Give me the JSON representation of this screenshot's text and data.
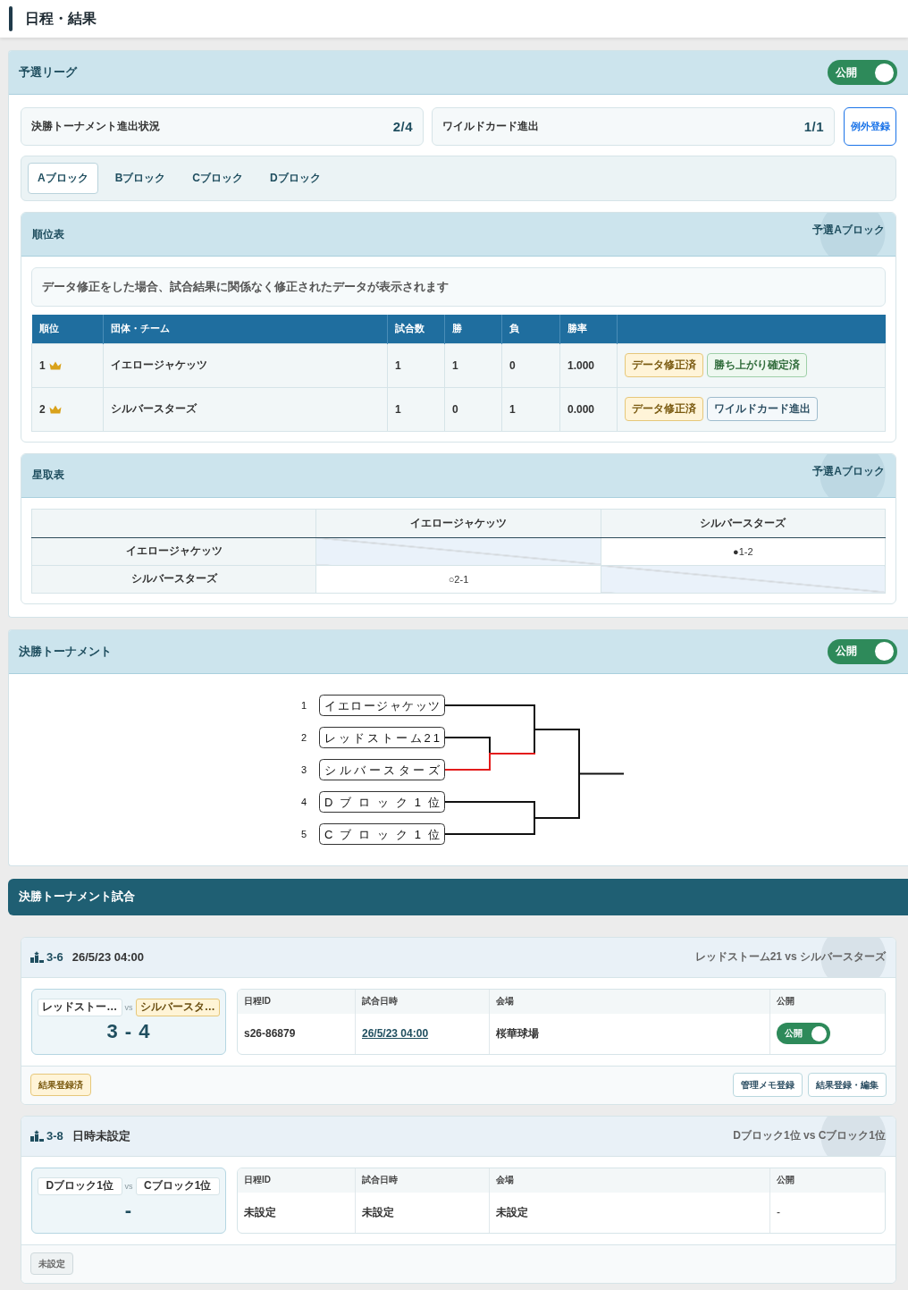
{
  "page_title": "日程・結果",
  "preliminary_league": {
    "title": "予選リーグ",
    "public_toggle": {
      "label": "公開",
      "on": true
    },
    "stats": [
      {
        "label": "決勝トーナメント進出状況",
        "value": "2/4"
      },
      {
        "label": "ワイルドカード進出",
        "value": "1/1"
      }
    ],
    "exception_button": "例外登録",
    "tabs": [
      {
        "label": "Aブロック",
        "selected": true
      },
      {
        "label": "Bブロック",
        "selected": false
      },
      {
        "label": "Cブロック",
        "selected": false
      },
      {
        "label": "Dブロック",
        "selected": false
      }
    ],
    "standings": {
      "title": "順位表",
      "block_label": "予選Aブロック",
      "note": "データ修正をした場合、試合結果に関係なく修正されたデータが表示されます",
      "columns": [
        "順位",
        "団体・チーム",
        "試合数",
        "勝",
        "負",
        "勝率"
      ],
      "rows": [
        {
          "rank": "1",
          "crown": true,
          "team": "イエロージャケッツ",
          "played": "1",
          "wins": "1",
          "losses": "0",
          "win_rate": "1.000",
          "tags": [
            {
              "label": "データ修正済",
              "kind": "modified"
            },
            {
              "label": "勝ち上がり確定済",
              "kind": "qualified"
            }
          ]
        },
        {
          "rank": "2",
          "crown": true,
          "team": "シルバースターズ",
          "played": "1",
          "wins": "0",
          "losses": "1",
          "win_rate": "0.000",
          "tags": [
            {
              "label": "データ修正済",
              "kind": "modified"
            },
            {
              "label": "ワイルドカード進出",
              "kind": "wildcard"
            }
          ]
        }
      ]
    },
    "star_table": {
      "title": "星取表",
      "block_label": "予選Aブロック",
      "columns": [
        "イエロージャケッツ",
        "シルバースターズ"
      ],
      "rows": [
        {
          "team": "イエロージャケッツ",
          "cells": [
            {
              "kind": "self"
            },
            {
              "kind": "result",
              "text": "●1-2"
            }
          ]
        },
        {
          "team": "シルバースターズ",
          "cells": [
            {
              "kind": "result",
              "text": "○2-1"
            },
            {
              "kind": "self"
            }
          ]
        }
      ]
    }
  },
  "final_tournament": {
    "title": "決勝トーナメント",
    "public_toggle": {
      "label": "公開",
      "on": true
    },
    "bracket": {
      "entries": [
        {
          "seed": "1",
          "team": "イエロージャケッツ",
          "advanced": false
        },
        {
          "seed": "2",
          "team": "レッドストーム21",
          "advanced": false
        },
        {
          "seed": "3",
          "team": "シルバースターズ",
          "advanced": true
        },
        {
          "seed": "4",
          "team": "Dブロック1位",
          "advanced": false
        },
        {
          "seed": "5",
          "team": "Cブロック1位",
          "advanced": false
        }
      ]
    }
  },
  "final_matches": {
    "title": "決勝トーナメント試合",
    "matches": [
      {
        "number": "3-6",
        "datetime": "26/5/23 04:00",
        "matchup": "レッドストーム21 vs シルバースターズ",
        "teams": [
          {
            "name": "レッドストー…",
            "winner": false
          },
          {
            "name": "シルバースタ…",
            "winner": true
          }
        ],
        "vs": "vs",
        "score": "3 - 4",
        "columns": [
          "日程ID",
          "試合日時",
          "会場",
          "公開"
        ],
        "schedule_id": "s26-86879",
        "date": {
          "kind": "link",
          "text": "26/5/23 04:00"
        },
        "venue": "桜華球場",
        "public": {
          "kind": "toggle",
          "label": "公開",
          "on": true
        },
        "status": {
          "kind": "registered",
          "label": "結果登録済"
        },
        "buttons": [
          "管理メモ登録",
          "結果登録・編集"
        ]
      },
      {
        "number": "3-8",
        "datetime": "日時未設定",
        "matchup": "Dブロック1位 vs Cブロック1位",
        "teams": [
          {
            "name": "Dブロック1位",
            "winner": false
          },
          {
            "name": "Cブロック1位",
            "winner": false
          }
        ],
        "vs": "vs",
        "score": "-",
        "columns": [
          "日程ID",
          "試合日時",
          "会場",
          "公開"
        ],
        "schedule_id": "未設定",
        "date": {
          "kind": "text",
          "text": "未設定"
        },
        "venue": "未設定",
        "public": {
          "kind": "text",
          "text": "-"
        },
        "status": {
          "kind": "unset",
          "label": "未設定"
        }
      }
    ]
  }
}
